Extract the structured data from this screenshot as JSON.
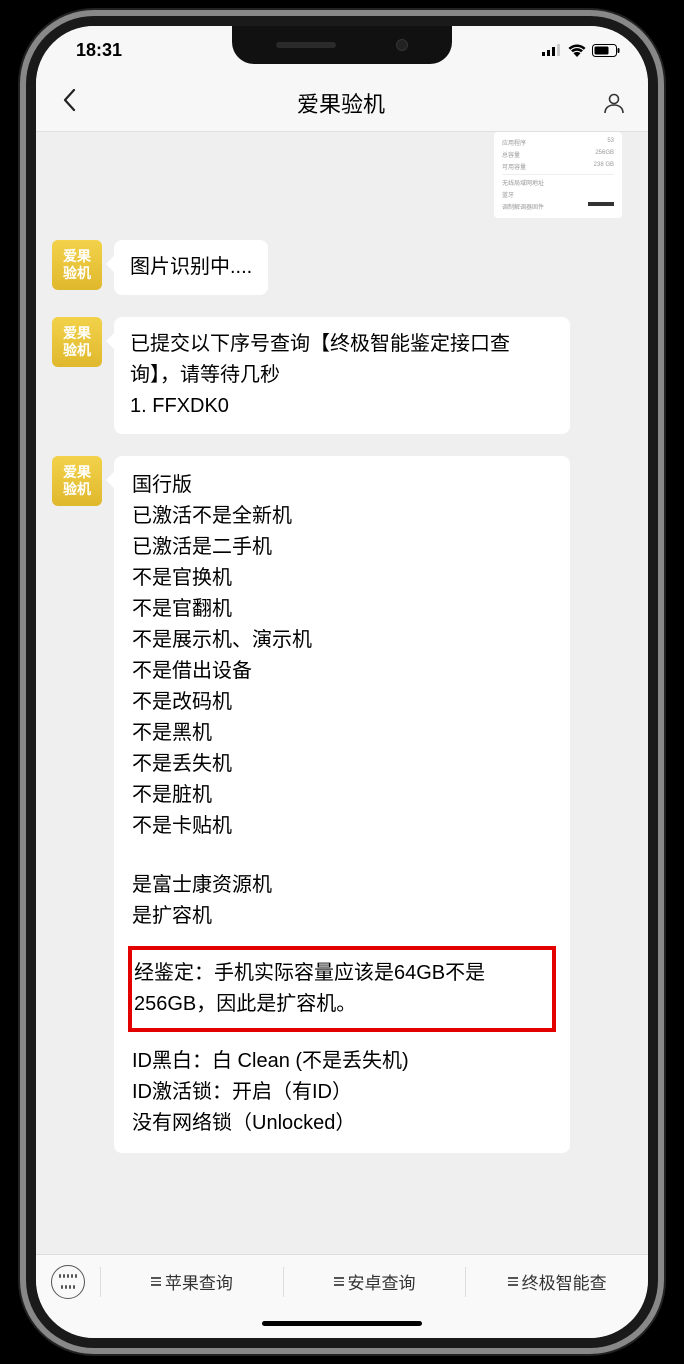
{
  "status": {
    "time": "18:31"
  },
  "nav": {
    "title": "爱果验机"
  },
  "avatar_text": "爱果\n验机",
  "thumb": {
    "r1l": "应用程序",
    "r1r": "53",
    "r2l": "总容量",
    "r2r": "256GB",
    "r3l": "可用容量",
    "r3r": "238 GB",
    "r4l": "无线局域网地址",
    "r5l": "蓝牙",
    "r6l": "调制解调器固件"
  },
  "msg1": "图片识别中....",
  "msg2_l1": "已提交以下序号查询【终极智能鉴定接口查询】，请等待几秒",
  "msg2_l2": "1. FFXDK0",
  "msg3": {
    "lines1": "国行版\n已激活不是全新机\n已激活是二手机\n不是官换机\n不是官翻机\n不是展示机、演示机\n不是借出设备\n不是改码机\n不是黑机\n不是丢失机\n不是脏机\n不是卡贴机",
    "lines2": "是富士康资源机\n是扩容机",
    "highlight": "经鉴定：手机实际容量应该是64GB不是 256GB，因此是扩容机。",
    "lines3": "ID黑白：白 Clean (不是丢失机)\nID激活锁：开启（有ID）\n没有网络锁（Unlocked）"
  },
  "bottom": {
    "item1": "苹果查询",
    "item2": "安卓查询",
    "item3": "终极智能查"
  }
}
